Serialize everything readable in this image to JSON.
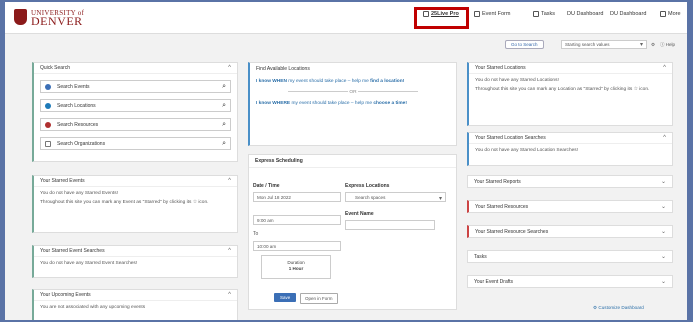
{
  "header": {
    "logo_line1": "UNIVERSITY of",
    "logo_line2": "DENVER",
    "nav": [
      "25Live Pro",
      "Event Form",
      "Tasks",
      "DU Dashboard",
      "DU Dashboard",
      "More"
    ]
  },
  "toolbar": {
    "go_to_search": "Go to Search",
    "search_type": "Starting search values",
    "help": "Help"
  },
  "quick_search": {
    "title": "Quick Search",
    "items": [
      "Search Events",
      "Search Locations",
      "Search Resources",
      "Search Organizations"
    ]
  },
  "starred_events": {
    "title": "Your Starred Events",
    "empty": "You do not have any Starred Events!",
    "hint": "Throughout this site you can mark any Event as \"Starred\" by clicking its ☆ icon."
  },
  "starred_event_searches": {
    "title": "Your Starred Event Searches",
    "empty": "You do not have any Starred Event Searches!"
  },
  "upcoming_events": {
    "title": "Your Upcoming Events",
    "empty": "You are not associated with any upcoming events"
  },
  "find_locations": {
    "title": "Find Available Locations",
    "when_prefix": "I know WHEN",
    "when_mid": " my event should take place – help me ",
    "when_link": "find a location!",
    "or": "OR",
    "where_prefix": "I know WHERE",
    "where_mid": " my event should take place – help me ",
    "where_link": "choose a time!"
  },
  "express": {
    "title": "Express Scheduling",
    "date_time_label": "Date / Time",
    "date_value": "Mon Jul 18 2022",
    "start_time": "9:00 am",
    "to_label": "To",
    "end_time": "10:00 am",
    "duration_label": "Duration",
    "duration_value": "1 Hour",
    "locations_label": "Express Locations",
    "locations_placeholder": "Search spaces",
    "event_name_label": "Event Name",
    "save": "Save",
    "open_in_form": "Open in Form"
  },
  "right": {
    "starred_locations": {
      "title": "Your Starred Locations",
      "empty": "You do not have any Starred Locations!",
      "hint": "Throughout this site you can mark any Location as \"Starred\" by clicking its ☆ icon."
    },
    "starred_location_searches": {
      "title": "Your Starred Location Searches",
      "empty": "You do not have any Starred Location Searches!"
    },
    "collapsed": [
      "Your Starred Reports",
      "Your Starred Resources",
      "Your Starred Resource Searches",
      "Tasks",
      "Your Event Drafts"
    ],
    "customize": "Customize Dashboard"
  },
  "colors": {
    "frame": "#5a73a6",
    "brand": "#8b1a1a",
    "highlight": "#c00000",
    "accent": "#2a6ea8"
  }
}
